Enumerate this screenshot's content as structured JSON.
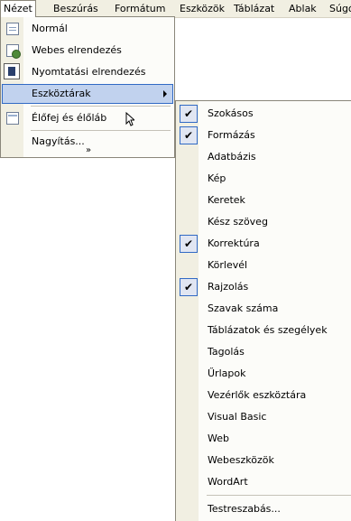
{
  "menubar": {
    "items": [
      {
        "label": "Nézet"
      },
      {
        "label": "Beszúrás"
      },
      {
        "label": "Formátum"
      },
      {
        "label": "Eszközök"
      },
      {
        "label": "Táblázat"
      },
      {
        "label": "Ablak"
      },
      {
        "label": "Súgó"
      }
    ]
  },
  "view_menu": {
    "items": [
      {
        "label": "Normál",
        "icon": "normal-view-icon"
      },
      {
        "label": "Webes elrendezés",
        "icon": "web-layout-icon"
      },
      {
        "label": "Nyomtatási elrendezés",
        "icon": "print-layout-icon",
        "checked": true
      },
      {
        "label": "Eszköztárak",
        "has_submenu": true,
        "highlighted": true
      },
      {
        "label": "Élőfej és élőláb",
        "icon": "header-footer-icon"
      },
      {
        "label": "Nagyítás..."
      }
    ],
    "expand_glyph": "»"
  },
  "toolbars_submenu": {
    "items": [
      {
        "label": "Szokásos",
        "checked": true
      },
      {
        "label": "Formázás",
        "checked": true
      },
      {
        "label": "Adatbázis",
        "checked": false
      },
      {
        "label": "Kép",
        "checked": false
      },
      {
        "label": "Keretek",
        "checked": false
      },
      {
        "label": "Kész szöveg",
        "checked": false
      },
      {
        "label": "Korrektúra",
        "checked": true
      },
      {
        "label": "Körlevél",
        "checked": false
      },
      {
        "label": "Rajzolás",
        "checked": true
      },
      {
        "label": "Szavak száma",
        "checked": false
      },
      {
        "label": "Táblázatok és szegélyek",
        "checked": false
      },
      {
        "label": "Tagolás",
        "checked": false
      },
      {
        "label": "Űrlapok",
        "checked": false
      },
      {
        "label": "Vezérlők eszköztára",
        "checked": false
      },
      {
        "label": "Visual Basic",
        "checked": false
      },
      {
        "label": "Web",
        "checked": false
      },
      {
        "label": "Webeszközök",
        "checked": false
      },
      {
        "label": "WordArt",
        "checked": false
      }
    ],
    "customize_label": "Testreszabás..."
  },
  "check_glyph": "✔",
  "colors": {
    "menu_bg": "#fcfcf9",
    "gutter": "#f1efe2",
    "highlight": "#c1d2ee",
    "highlight_border": "#316ac5"
  }
}
